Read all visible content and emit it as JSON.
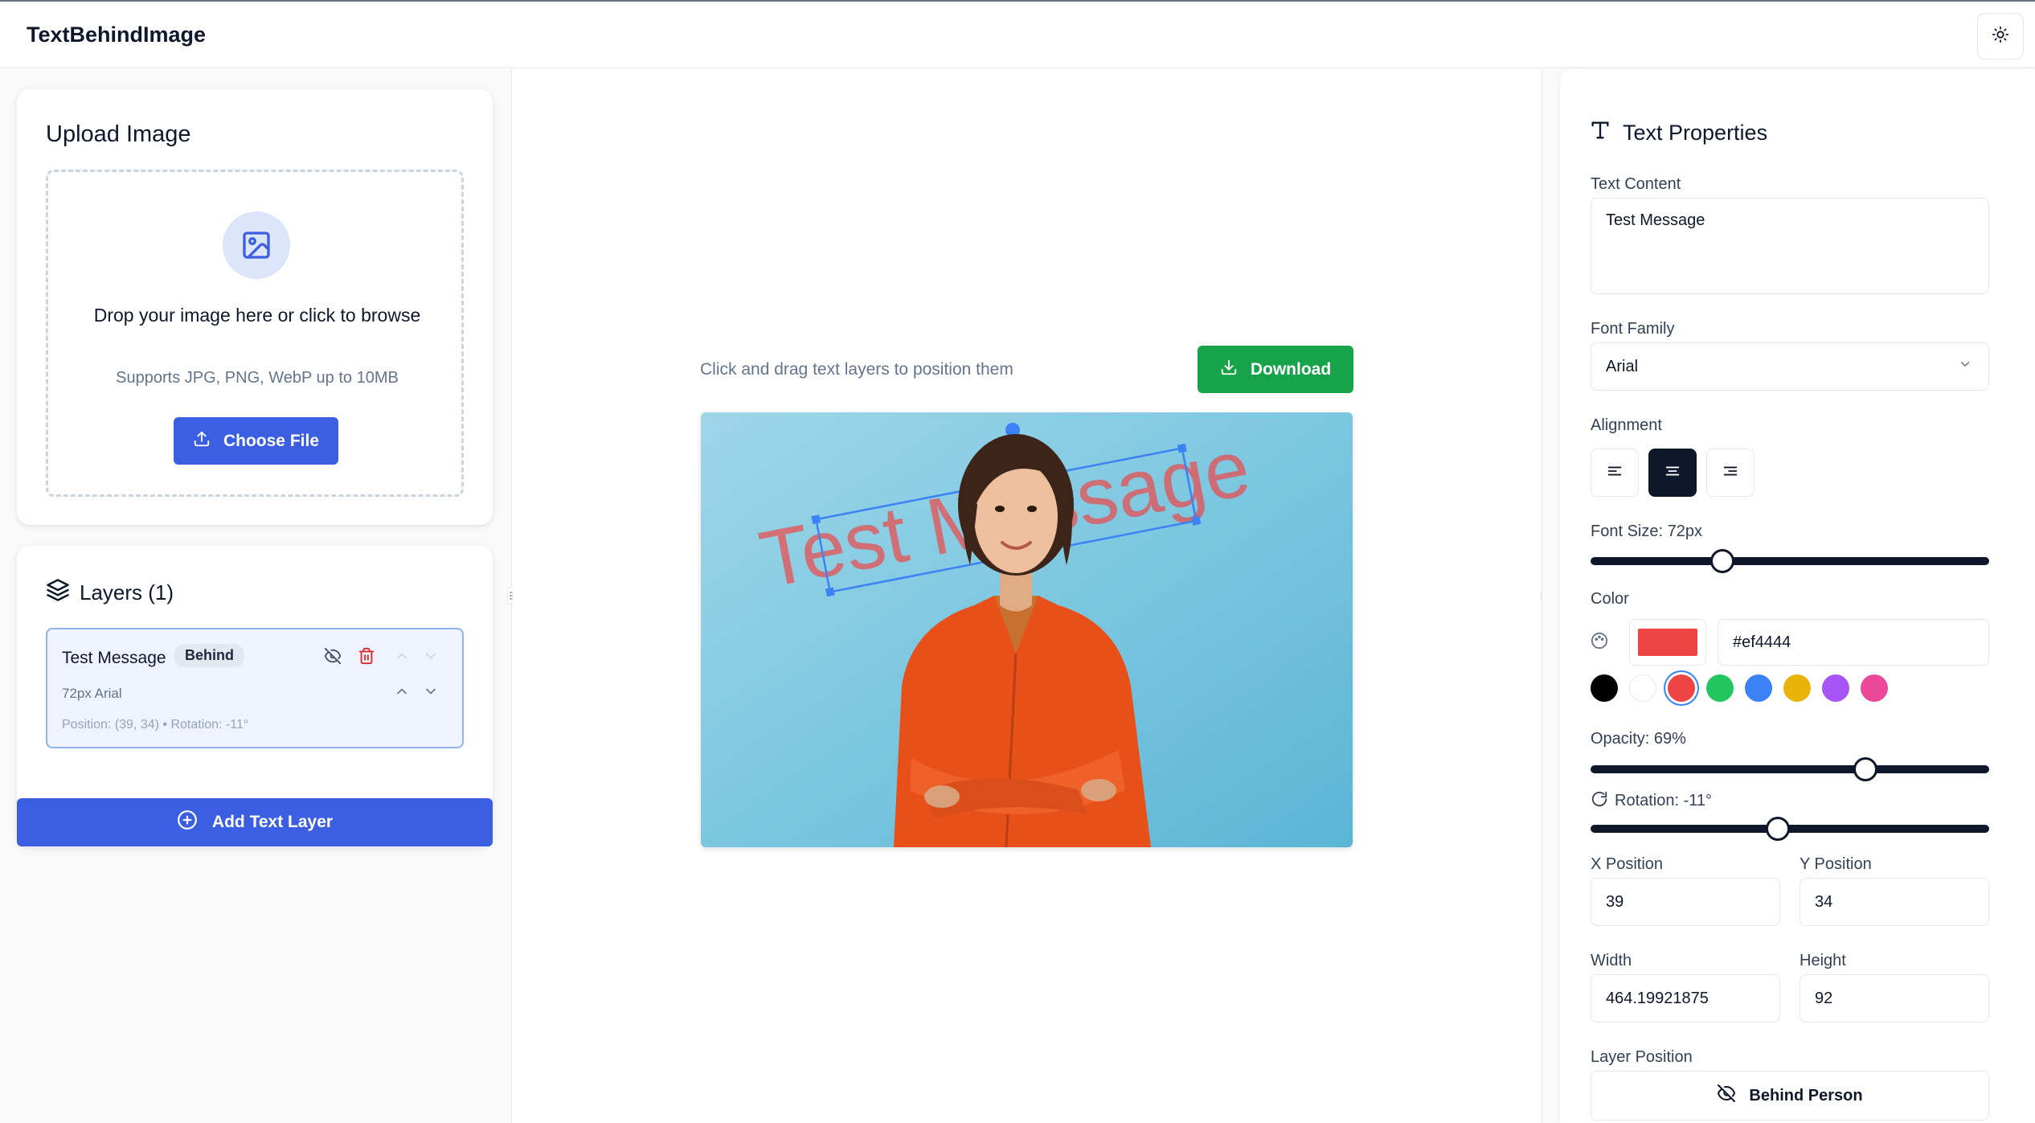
{
  "app": {
    "title": "TextBehindImage"
  },
  "upload": {
    "title": "Upload Image",
    "drop_text": "Drop your image here or click to browse",
    "supports": "Supports JPG, PNG, WebP up to 10MB",
    "choose_label": "Choose File"
  },
  "layers": {
    "title": "Layers (1)",
    "items": [
      {
        "name": "Test Message",
        "badge": "Behind",
        "meta": "72px Arial",
        "position": "Position: (39, 34) • Rotation: -11°"
      }
    ],
    "add_label": "Add Text Layer"
  },
  "canvas": {
    "hint": "Click and drag text layers to position them",
    "download_label": "Download",
    "overlay_text": "Test Message",
    "text_color": "#ef4444",
    "opacity": 0.69,
    "rotation_deg": -11
  },
  "properties": {
    "title": "Text Properties",
    "text_content_label": "Text Content",
    "text_content_value": "Test Message",
    "font_family_label": "Font Family",
    "font_family_value": "Arial",
    "alignment_label": "Alignment",
    "alignment_options": [
      "left",
      "center",
      "right"
    ],
    "alignment_selected": "center",
    "font_size_label": "Font Size: 72px",
    "font_size_fraction": 0.33,
    "color_label": "Color",
    "color_value": "#ef4444",
    "swatches": [
      "#000000",
      "#ffffff",
      "#ef4444",
      "#22c55e",
      "#3b82f6",
      "#eab308",
      "#a855f7",
      "#ec4899"
    ],
    "swatch_selected": "#ef4444",
    "opacity_label": "Opacity: 69%",
    "opacity_fraction": 0.69,
    "rotation_label": "Rotation: -11°",
    "rotation_fraction": 0.47,
    "x_label": "X Position",
    "x_value": "39",
    "y_label": "Y Position",
    "y_value": "34",
    "width_label": "Width",
    "width_value": "464.19921875",
    "height_label": "Height",
    "height_value": "92",
    "layer_position_label": "Layer Position",
    "layer_position_value": "Behind Person"
  }
}
